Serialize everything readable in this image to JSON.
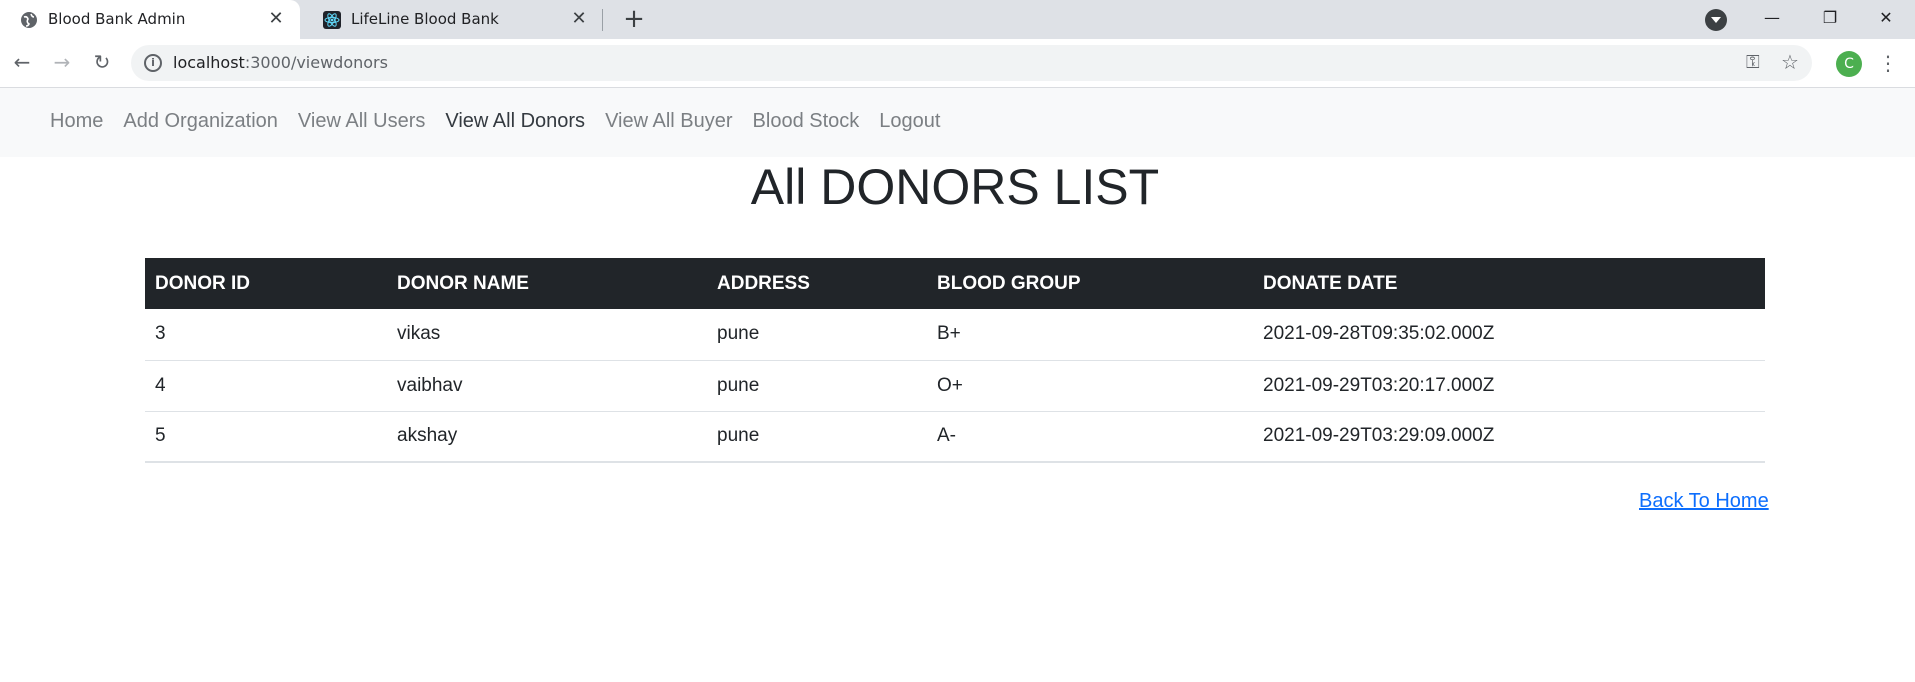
{
  "browser": {
    "tabs": [
      {
        "title": "Blood Bank Admin",
        "active": true
      },
      {
        "title": "LifeLine Blood Bank",
        "active": false
      }
    ],
    "new_tab_label": "+",
    "url_host": "localhost",
    "url_path": ":3000/viewdonors",
    "profile_initial": "C"
  },
  "nav": {
    "items": [
      {
        "label": "Home"
      },
      {
        "label": "Add Organization"
      },
      {
        "label": "View All Users"
      },
      {
        "label": "View All Donors"
      },
      {
        "label": "View All Buyer"
      },
      {
        "label": "Blood Stock"
      },
      {
        "label": "Logout"
      }
    ],
    "active_index": 3
  },
  "page": {
    "title": "All DONORS LIST",
    "back_link": "Back To Home"
  },
  "table": {
    "columns": [
      "DONOR ID",
      "DONOR NAME",
      "ADDRESS",
      "BLOOD GROUP",
      "DONATE DATE"
    ],
    "rows": [
      [
        "3",
        "vikas",
        "pune",
        "B+",
        "2021-09-28T09:35:02.000Z"
      ],
      [
        "4",
        "vaibhav",
        "pune",
        "O+",
        "2021-09-29T03:20:17.000Z"
      ],
      [
        "5",
        "akshay",
        "pune",
        "A-",
        "2021-09-29T03:29:09.000Z"
      ]
    ]
  },
  "colors": {
    "table_header_bg": "#212529",
    "navbar_bg": "#f8f9fa",
    "link": "#0d6efd",
    "profile": "#4caf50"
  }
}
